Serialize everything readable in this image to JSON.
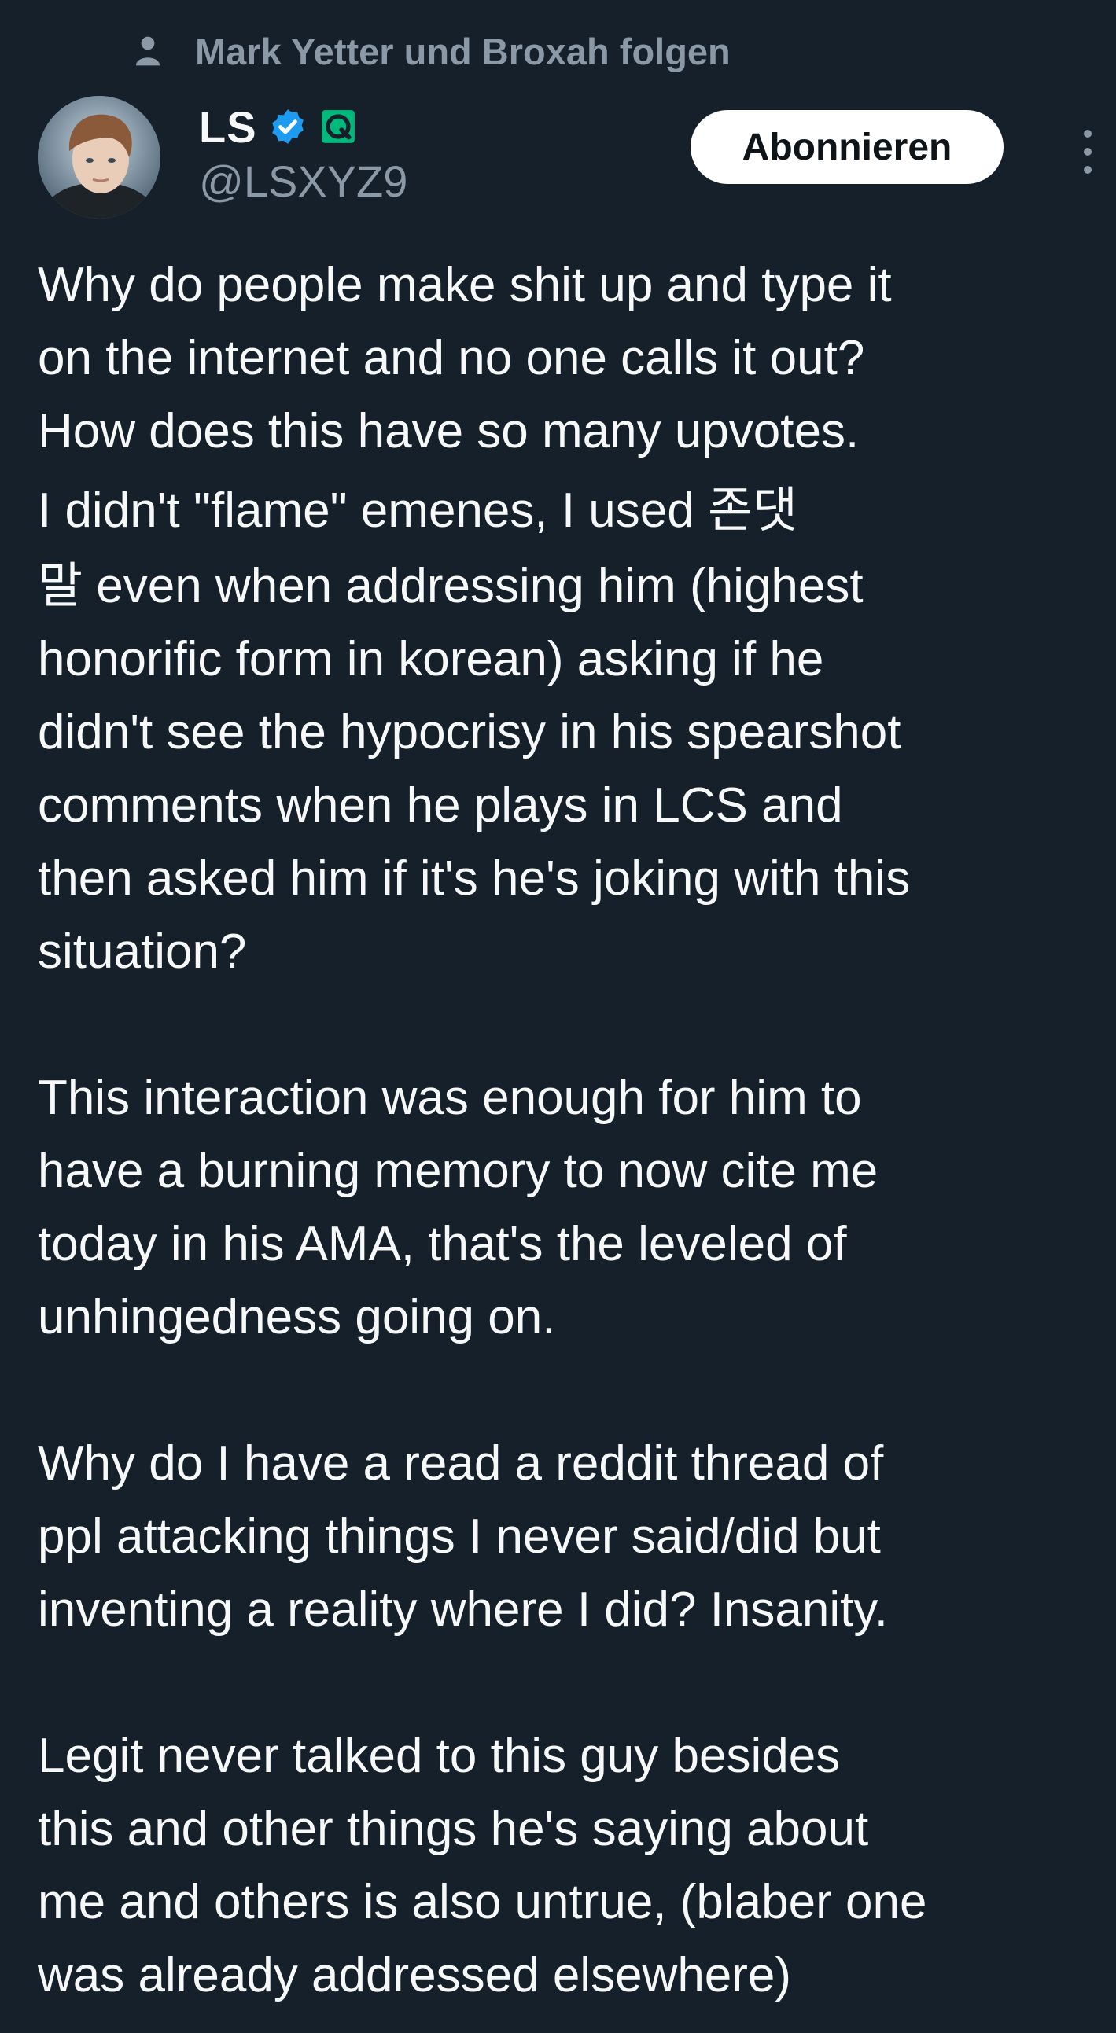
{
  "context": {
    "follow_text": "Mark Yetter und Broxah folgen"
  },
  "author": {
    "display_name": "LS",
    "handle": "@LSXYZ9",
    "verified_badge": "verified-badge-icon",
    "affiliate_badge": "affiliate-badge-icon"
  },
  "actions": {
    "subscribe_label": "Abonnieren",
    "more_icon": "more-options-icon"
  },
  "tweet": {
    "paragraphs": [
      {
        "lines": [
          "Why do people make shit up and type it",
          "on the internet and no one calls it out?",
          "How does this have so many upvotes.",
          "I didn't  \"flame\" emenes, I used 존댓",
          "말 even when addressing him (highest",
          "honorific form in korean) asking if he",
          "didn't see the hypocrisy in his spearshot",
          "comments when he plays in LCS and",
          "then asked him if it's he's joking with this",
          "situation?"
        ]
      },
      {
        "lines": [
          "This interaction was enough for him to",
          "have a burning memory to now cite me",
          "today in his AMA, that's the leveled of",
          "unhingedness going on."
        ]
      },
      {
        "lines": [
          "Why do I have a read a reddit thread of",
          "ppl attacking things I never said/did but",
          "inventing a reality where I did? Insanity."
        ]
      },
      {
        "lines": [
          "Legit never talked to this guy besides",
          "this and other things he's saying about",
          "me and others is also untrue, (blaber one",
          "was already addressed elsewhere)"
        ]
      }
    ]
  },
  "colors": {
    "background": "#15202b",
    "text_primary": "#f7f9f9",
    "text_secondary": "#8b98a5",
    "verified_blue": "#1d9bf0",
    "affiliate_green": "#00ba7c",
    "button_bg": "#ffffff"
  }
}
